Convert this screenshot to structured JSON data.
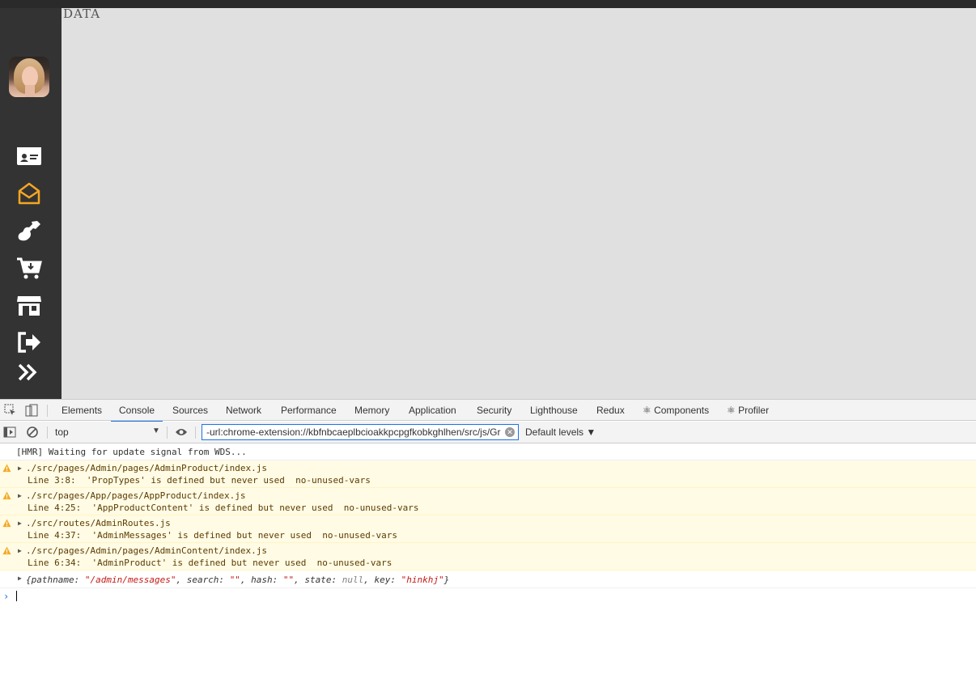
{
  "app": {
    "page_heading": "DATA"
  },
  "sidebar": {
    "items": [
      {
        "icon": "id-card-icon",
        "color": "#ffffff"
      },
      {
        "icon": "envelope-open-icon",
        "color": "#f5a623"
      },
      {
        "icon": "guitar-icon",
        "color": "#ffffff"
      },
      {
        "icon": "cart-plus-icon",
        "color": "#ffffff"
      },
      {
        "icon": "store-icon",
        "color": "#ffffff"
      },
      {
        "icon": "sign-out-icon",
        "color": "#ffffff"
      },
      {
        "icon": "double-chevron-right-icon",
        "color": "#ffffff"
      }
    ]
  },
  "devtools": {
    "tabs": [
      "Elements",
      "Console",
      "Sources",
      "Network",
      "Performance",
      "Memory",
      "Application",
      "Security",
      "Lighthouse",
      "Redux",
      "⚛ Components",
      "⚛ Profiler"
    ],
    "active_tab": "Console",
    "toolbar": {
      "context": "top",
      "filter_value": "-url:chrome-extension://kbfnbcaeplbcioakkpcpgfkobkghlhen/src/js/Gr",
      "levels": "Default levels ▼"
    },
    "console": {
      "info": "[HMR] Waiting for update signal from WDS...",
      "warnings": [
        {
          "file": "./src/pages/Admin/pages/AdminProduct/index.js",
          "detail": "Line 3:8:  'PropTypes' is defined but never used  no-unused-vars"
        },
        {
          "file": "./src/pages/App/pages/AppProduct/index.js",
          "detail": "Line 4:25:  'AppProductContent' is defined but never used  no-unused-vars"
        },
        {
          "file": "./src/routes/AdminRoutes.js",
          "detail": "Line 4:37:  'AdminMessages' is defined but never used  no-unused-vars"
        },
        {
          "file": "./src/pages/Admin/pages/AdminContent/index.js",
          "detail": "Line 6:34:  'AdminProduct' is defined but never used  no-unused-vars"
        }
      ],
      "object": {
        "open": "{pathname: ",
        "pathname": "\"/admin/messages\"",
        "s1": ", search: ",
        "search": "\"\"",
        "s2": ", hash: ",
        "hash": "\"\"",
        "s3": ", state: ",
        "state": "null",
        "s4": ", key: ",
        "key": "\"hinkhj\"",
        "close": "}"
      },
      "prompt": "›"
    }
  },
  "colors": {
    "sidebar_bg": "#333333",
    "main_bg": "#e0e0e0",
    "accent": "#1a73e8",
    "warning_bg": "#fffbe5",
    "active_nav": "#f5a623"
  }
}
